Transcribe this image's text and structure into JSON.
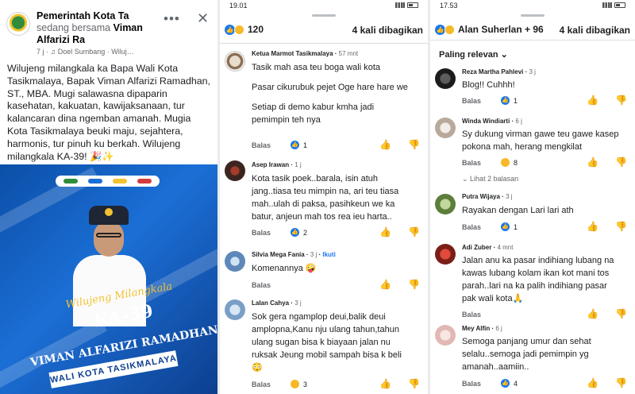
{
  "left_post": {
    "page_name": "Pemerintah Kota Ta",
    "with_text": "sedang bersama",
    "tagged": "Viman Alfarizi Ra",
    "meta": "7 j · ♫ Doel Sumbang · Wiluj…",
    "body": "Wilujeng milangkala ka Bapa Wali Kota Tasikmalaya, Bapak Viman Alfarizi Ramadhan, ST., MBA. Mugi salawasna dipaparin kasehatan, kakuatan, kawijaksanaan, tur kalancaran dina ngemban amanah. Mugia Kota Tasikmalaya beuki maju, sejahtera, harmonis, tur pinuh ku berkah. Wilujeng milangkala KA-39! 🎉✨",
    "banner": {
      "script": "Wilujeng Milangkala",
      "ka": "KA-39",
      "name": "VIMAN ALFARIZI RAMADHAN ST., MBA.",
      "title": "WALI KOTA TASIKMALAYA"
    }
  },
  "middle": {
    "status_time": "19.01",
    "reaction_count": "120",
    "shares": "4 kali dibagikan",
    "comments": [
      {
        "name": "Ketua Marmot Tasikmalaya",
        "time": "57 mnt",
        "text": [
          "Tasik mah asa teu boga wali kota",
          "",
          "Pasar cikurubuk pejet Oge hare hare  we",
          "",
          " Setiap di demo kabur kmha jadi",
          "pemimpin teh nya"
        ],
        "reply": "Balas",
        "likes": "1"
      },
      {
        "name": "Asep Irawan",
        "time": "1 j",
        "text": [
          "Kota tasik poek..barala, isin atuh",
          "jang..tiasa teu mimpin na, ari teu tiasa",
          "mah..ulah di paksa, pasihkeun we ka",
          "batur, anjeun mah tos rea ieu harta.."
        ],
        "reply": "Balas",
        "likes": "2"
      },
      {
        "name": "Silvia Mega Fania",
        "time": "3 j",
        "follow": "Ikuti",
        "text": [
          "Komenannya 🤪"
        ],
        "reply": "Balas",
        "likes": ""
      },
      {
        "name": "Lalan Cahya",
        "time": "3 j",
        "text": [
          "Sok gera ngamplop deui,balik deui",
          "amplopna,Kanu nju ulang tahun,tahun",
          "ulang sugan bisa k biayaan jalan nu",
          "ruksak Jeung mobil sampah bisa k beli",
          "😳"
        ],
        "reply": "Balas",
        "likes": "3"
      }
    ]
  },
  "right": {
    "status_time": "17.53",
    "reacts_label": "Alan Suherlan + 96",
    "shares": "4 kali dibagikan",
    "sort_label": "Paling relevan",
    "comments": [
      {
        "name": "Reza Martha Pahlevi",
        "time": "3 j",
        "text": [
          "Blog!! Cuhhh!"
        ],
        "reply": "Balas",
        "likes": "1"
      },
      {
        "name": "Winda Windiarti",
        "time": "6 j",
        "text": [
          "Sy dukung virman gawe teu gawe kasep",
          "pokona mah, herang mengkilat"
        ],
        "reply": "Balas",
        "likes": "8",
        "more": "Lihat 2 balasan"
      },
      {
        "name": "Putra Wijaya",
        "time": "3 j",
        "text": [
          "Rayakan dengan Lari lari ath"
        ],
        "reply": "Balas",
        "likes": "1"
      },
      {
        "name": "Adi Zuber",
        "time": "4 mnt",
        "text": [
          "Jalan anu ka pasar indihiang lubang na",
          "kawas lubang kolam ikan kot mani tos",
          "parah..lari na ka palih indihiang pasar",
          "pak wali kota🙏"
        ],
        "reply": "Balas",
        "likes": ""
      },
      {
        "name": "Mey Alfin",
        "time": "6 j",
        "text": [
          "Semoga panjang umur dan sehat",
          "selalu..semoga jadi pemimpin yg",
          "amanah..aamiin.."
        ],
        "reply": "Balas",
        "likes": "4"
      }
    ]
  }
}
